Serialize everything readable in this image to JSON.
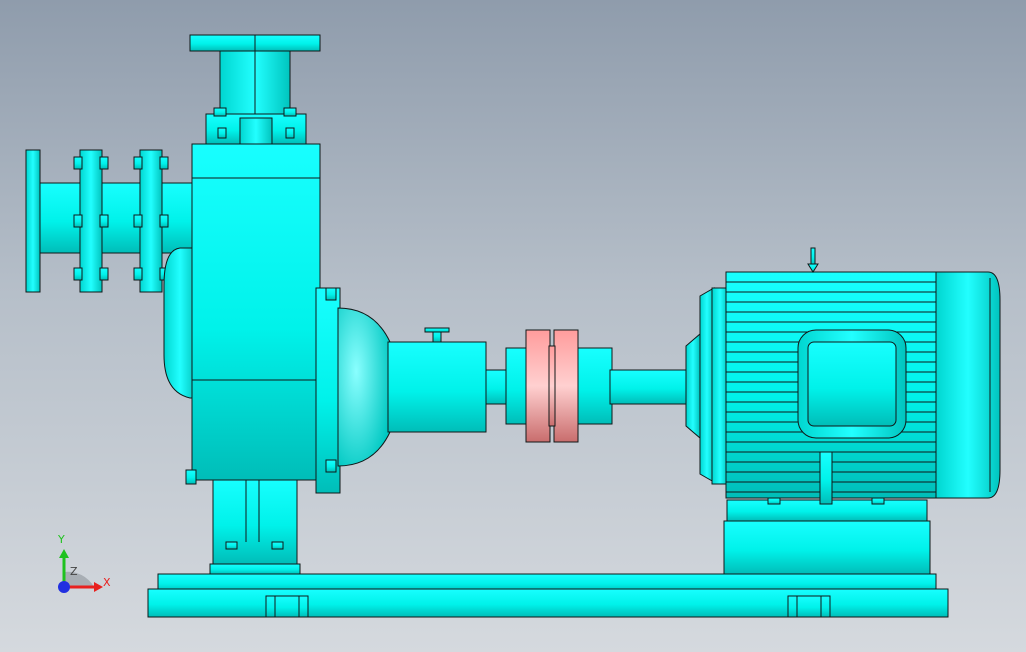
{
  "viewport": {
    "background_top": "#8f9cac",
    "background_bottom": "#d5d9de"
  },
  "model": {
    "body_color": "#00ffee",
    "coupling_color": "#f29a9a",
    "edge_color": "#101818"
  },
  "triad": {
    "x_label": "X",
    "y_label": "Y",
    "z_label": "Z",
    "x_color": "#e8201e",
    "y_color": "#1fc21f",
    "z_color": "#2130e0"
  }
}
